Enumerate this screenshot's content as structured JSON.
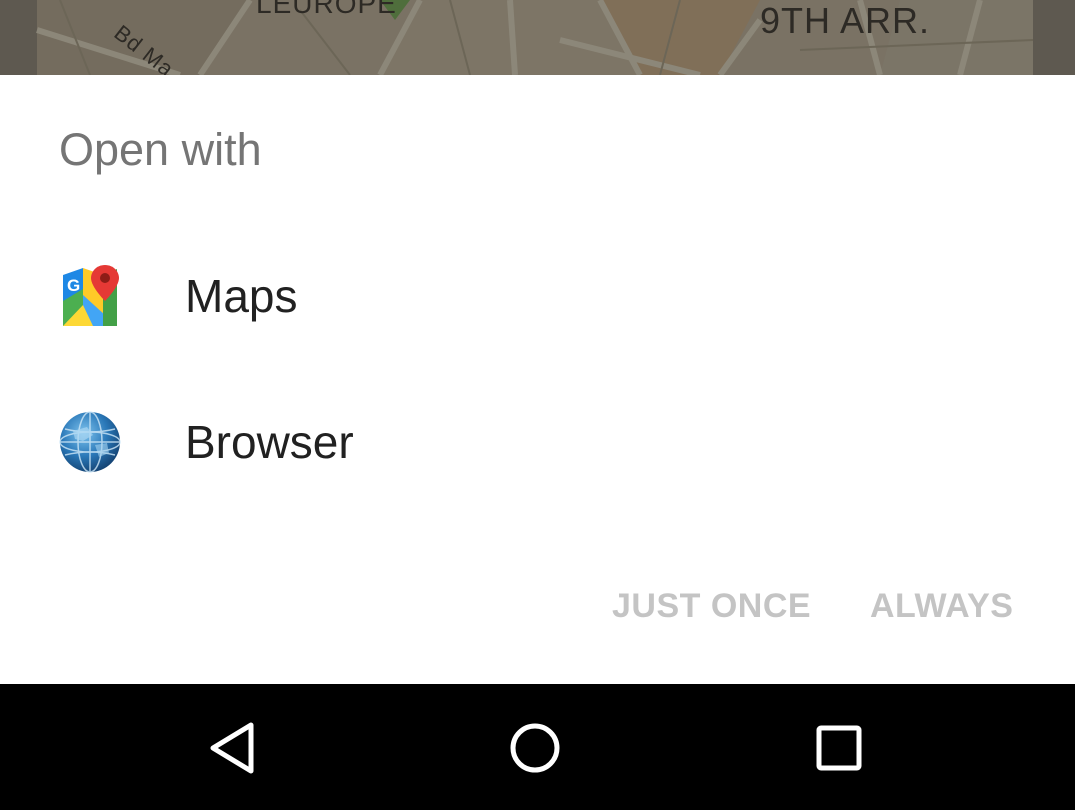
{
  "background_map": {
    "labels": {
      "europe": "LEUROPE",
      "arrondissement": "9TH ARR.",
      "boulevard": "Bd Ma"
    }
  },
  "dialog": {
    "title": "Open with",
    "apps": [
      {
        "label": "Maps",
        "icon": "google-maps-icon"
      },
      {
        "label": "Browser",
        "icon": "browser-globe-icon"
      }
    ],
    "actions": {
      "just_once": "JUST ONCE",
      "always": "ALWAYS"
    },
    "colors": {
      "title": "#757575",
      "app_label": "#212121",
      "disabled_action": "#c4c4c4",
      "sheet_background": "#ffffff"
    }
  },
  "navigation_bar": {
    "buttons": [
      {
        "icon": "back-triangle-icon"
      },
      {
        "icon": "home-circle-icon"
      },
      {
        "icon": "recents-square-icon"
      }
    ],
    "colors": {
      "background": "#000000",
      "icon": "#ffffff"
    }
  }
}
